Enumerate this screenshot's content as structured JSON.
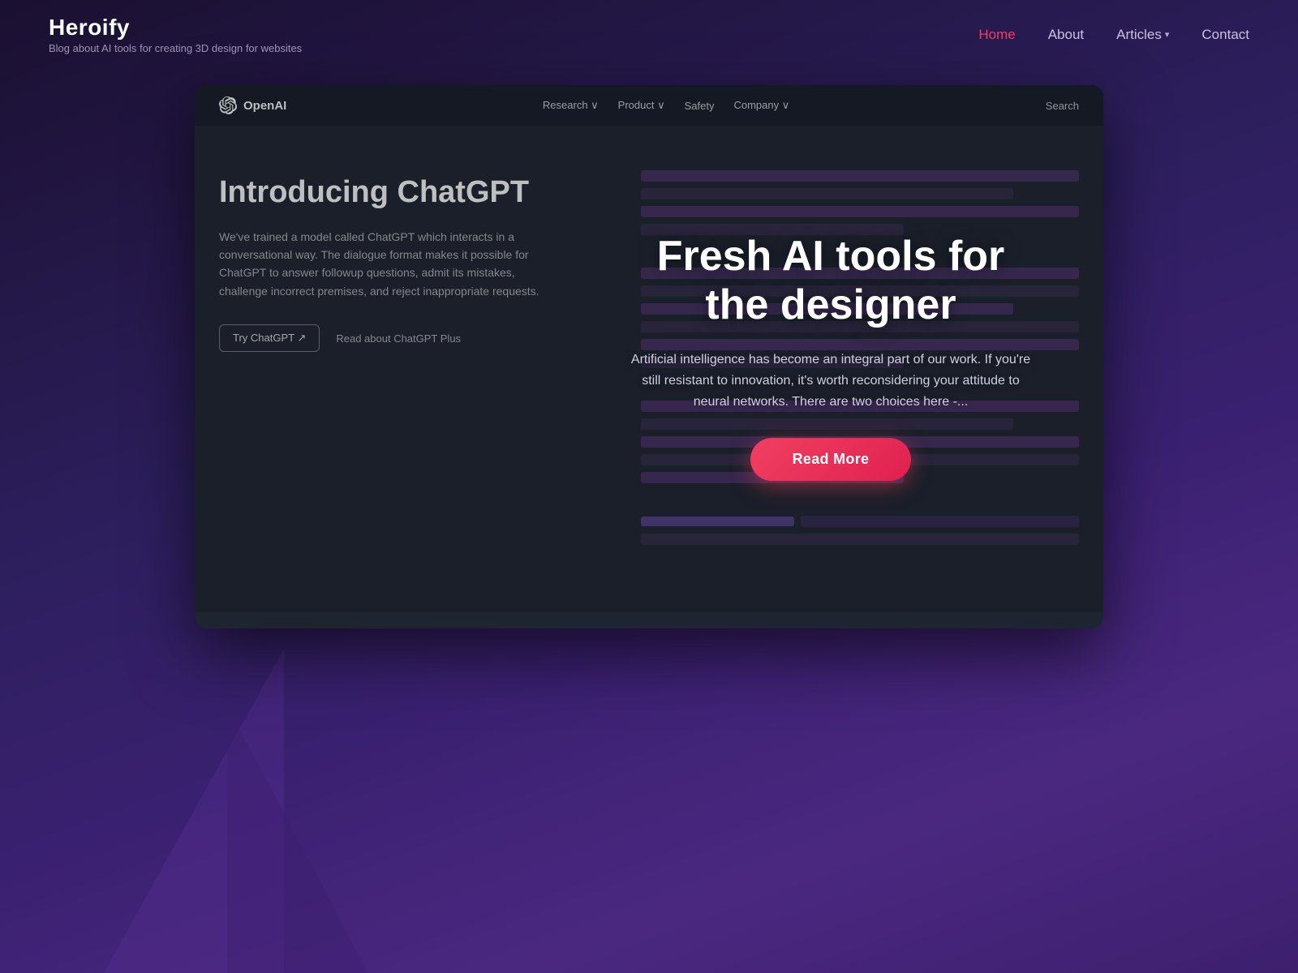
{
  "brand": {
    "title": "Heroify",
    "subtitle": "Blog about AI tools for creating 3D design for websites"
  },
  "nav": {
    "home_label": "Home",
    "about_label": "About",
    "articles_label": "Articles",
    "contact_label": "Contact",
    "active": "Home"
  },
  "inner_site": {
    "logo_text": "OpenAI",
    "nav_links": [
      {
        "label": "Research ∨"
      },
      {
        "label": "Product ∨"
      },
      {
        "label": "Safety"
      },
      {
        "label": "Company ∨"
      }
    ],
    "search_label": "Search",
    "hero_title": "Introducing ChatGPT",
    "hero_body": "We've trained a model called ChatGPT which interacts in a conversational way. The dialogue format makes it possible for ChatGPT to answer followup questions, admit its mistakes, challenge incorrect premises, and reject inappropriate requests.",
    "btn_try": "Try ChatGPT ↗",
    "btn_read": "Read about ChatGPT Plus"
  },
  "overlay": {
    "title": "Fresh AI tools for the designer",
    "description": "Artificial intelligence has become an integral part of our work. If you're still resistant to innovation, it's worth reconsidering your attitude to neural networks. There are two choices here -...",
    "read_more_label": "Read More"
  },
  "colors": {
    "accent": "#f04060",
    "nav_active": "#f04060",
    "bg_dark": "#1a1030"
  }
}
